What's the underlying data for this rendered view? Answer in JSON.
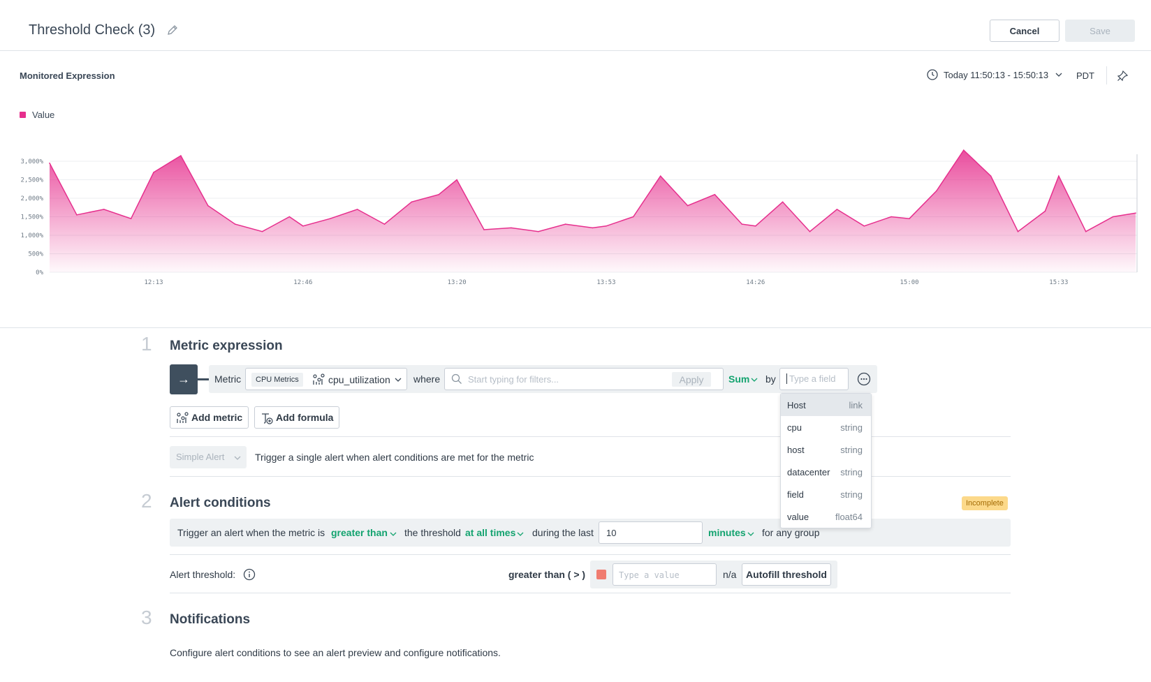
{
  "header": {
    "title": "Threshold Check (3)",
    "cancel_label": "Cancel",
    "save_label": "Save"
  },
  "chart_panel": {
    "title": "Monitored Expression",
    "time_range": "Today 11:50:13 - 15:50:13",
    "timezone": "PDT"
  },
  "chart_data": {
    "type": "area",
    "series": [
      {
        "name": "Value",
        "color": "#e62f8d",
        "x": [
          "11:50",
          "11:56",
          "12:02",
          "12:08",
          "12:13",
          "12:19",
          "12:25",
          "12:31",
          "12:37",
          "12:43",
          "12:46",
          "12:52",
          "12:58",
          "13:04",
          "13:10",
          "13:16",
          "13:20",
          "13:26",
          "13:32",
          "13:38",
          "13:44",
          "13:50",
          "13:53",
          "13:59",
          "14:05",
          "14:11",
          "14:17",
          "14:23",
          "14:26",
          "14:32",
          "14:38",
          "14:44",
          "14:50",
          "14:56",
          "15:00",
          "15:06",
          "15:12",
          "15:18",
          "15:24",
          "15:30",
          "15:33",
          "15:39",
          "15:45",
          "15:50"
        ],
        "values": [
          2950,
          1550,
          1700,
          1450,
          2700,
          3150,
          1800,
          1300,
          1100,
          1500,
          1250,
          1450,
          1700,
          1300,
          1900,
          2100,
          2500,
          1150,
          1200,
          1100,
          1300,
          1200,
          1250,
          1500,
          2600,
          1800,
          2100,
          1300,
          1250,
          1900,
          1100,
          1700,
          1250,
          1500,
          1450,
          2200,
          3300,
          2600,
          1100,
          1650,
          2600,
          1100,
          1500,
          1600
        ]
      }
    ],
    "ylim": [
      0,
      3000
    ],
    "y_ticks": [
      "0%",
      "500%",
      "1,000%",
      "1,500%",
      "2,000%",
      "2,500%",
      "3,000%"
    ],
    "x_ticks": [
      "12:13",
      "12:46",
      "13:20",
      "13:53",
      "14:26",
      "15:00",
      "15:33"
    ],
    "grid": true,
    "legend": "top-left"
  },
  "section1": {
    "number": "1",
    "title": "Metric expression",
    "arrow": "→",
    "metric_label": "Metric",
    "dataset_tag": "CPU Metrics",
    "metric_name": "cpu_utilization",
    "where_label": "where",
    "filter_placeholder": "Start typing for filters...",
    "apply_label": "Apply",
    "aggregation": "Sum",
    "by_label": "by",
    "field_placeholder": "Type a field",
    "add_metric_label": "Add metric",
    "add_formula_label": "Add formula",
    "alert_type": "Simple Alert",
    "alert_type_desc": "Trigger a single alert when alert conditions are met for the metric"
  },
  "field_dropdown": {
    "items": [
      {
        "name": "Host",
        "type": "link"
      },
      {
        "name": "cpu",
        "type": "string"
      },
      {
        "name": "host",
        "type": "string"
      },
      {
        "name": "datacenter",
        "type": "string"
      },
      {
        "name": "field",
        "type": "string"
      },
      {
        "name": "value",
        "type": "float64"
      }
    ]
  },
  "section2": {
    "number": "2",
    "title": "Alert conditions",
    "status_badge": "Incomplete",
    "cond_prefix": "Trigger an alert when the metric is",
    "comparison": "greater than",
    "cond_mid": "the threshold",
    "frequency": "at all times",
    "cond_during": "during the last",
    "window_value": "10",
    "window_unit": "minutes",
    "cond_suffix": "for any group",
    "threshold_label": "Alert threshold:",
    "threshold_op": "greater than ( > )",
    "threshold_placeholder": "Type a value",
    "threshold_na": "n/a",
    "autofill_label": "Autofill threshold",
    "threshold_color": "#f07c70"
  },
  "section3": {
    "number": "3",
    "title": "Notifications",
    "description": "Configure alert conditions to see an alert preview and configure notifications."
  }
}
